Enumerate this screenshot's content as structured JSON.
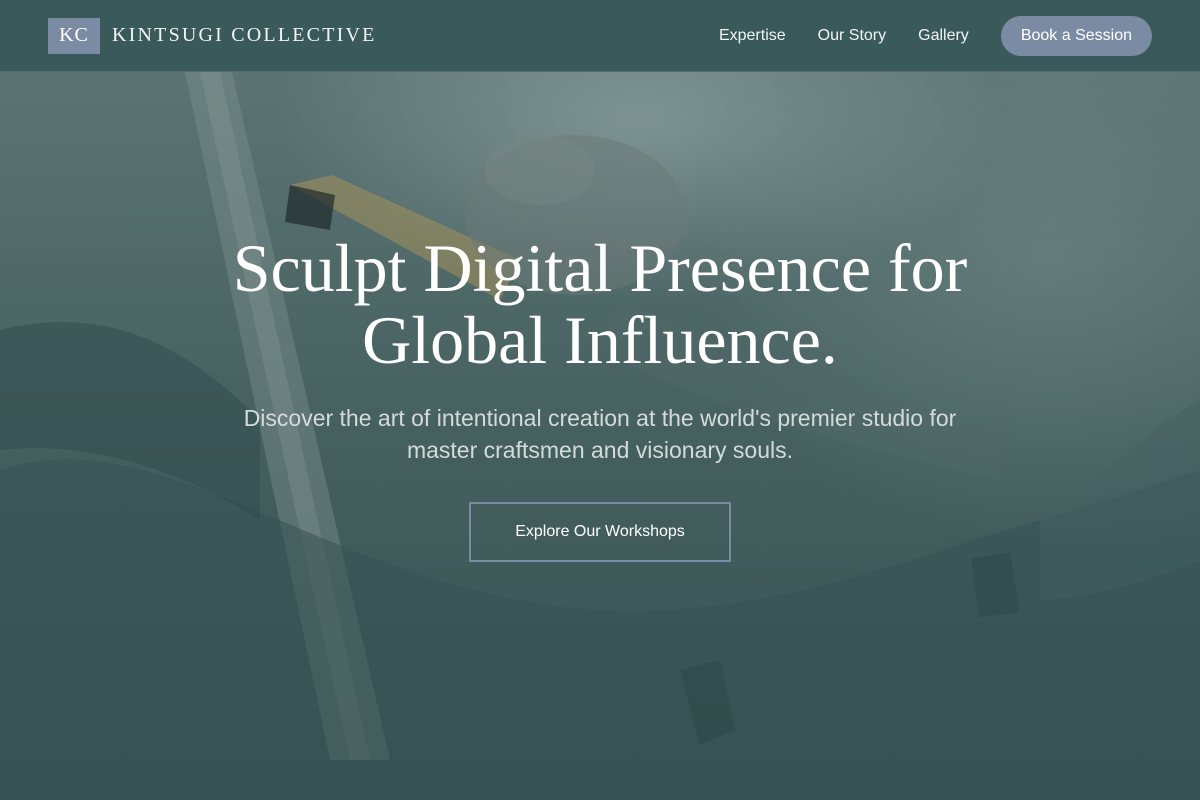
{
  "header": {
    "logo_mark": "KC",
    "brand_name": "KINTSUGI COLLECTIVE",
    "nav": [
      {
        "label": "Expertise"
      },
      {
        "label": "Our Story"
      },
      {
        "label": "Gallery"
      }
    ],
    "cta_label": "Book a Session"
  },
  "hero": {
    "title_line1": "Sculpt Digital Presence for",
    "title_line2": "Global Influence.",
    "subtitle_line1": "Discover the art of intentional creation at the world's premier studio for",
    "subtitle_line2": "master craftsmen and visionary souls.",
    "button_label": "Explore Our Workshops"
  },
  "colors": {
    "header_bg": "#39595a",
    "accent": "#7b8ba4",
    "hero_tint": "#4d6767"
  },
  "icons": [
    "kc-logo-mark"
  ]
}
